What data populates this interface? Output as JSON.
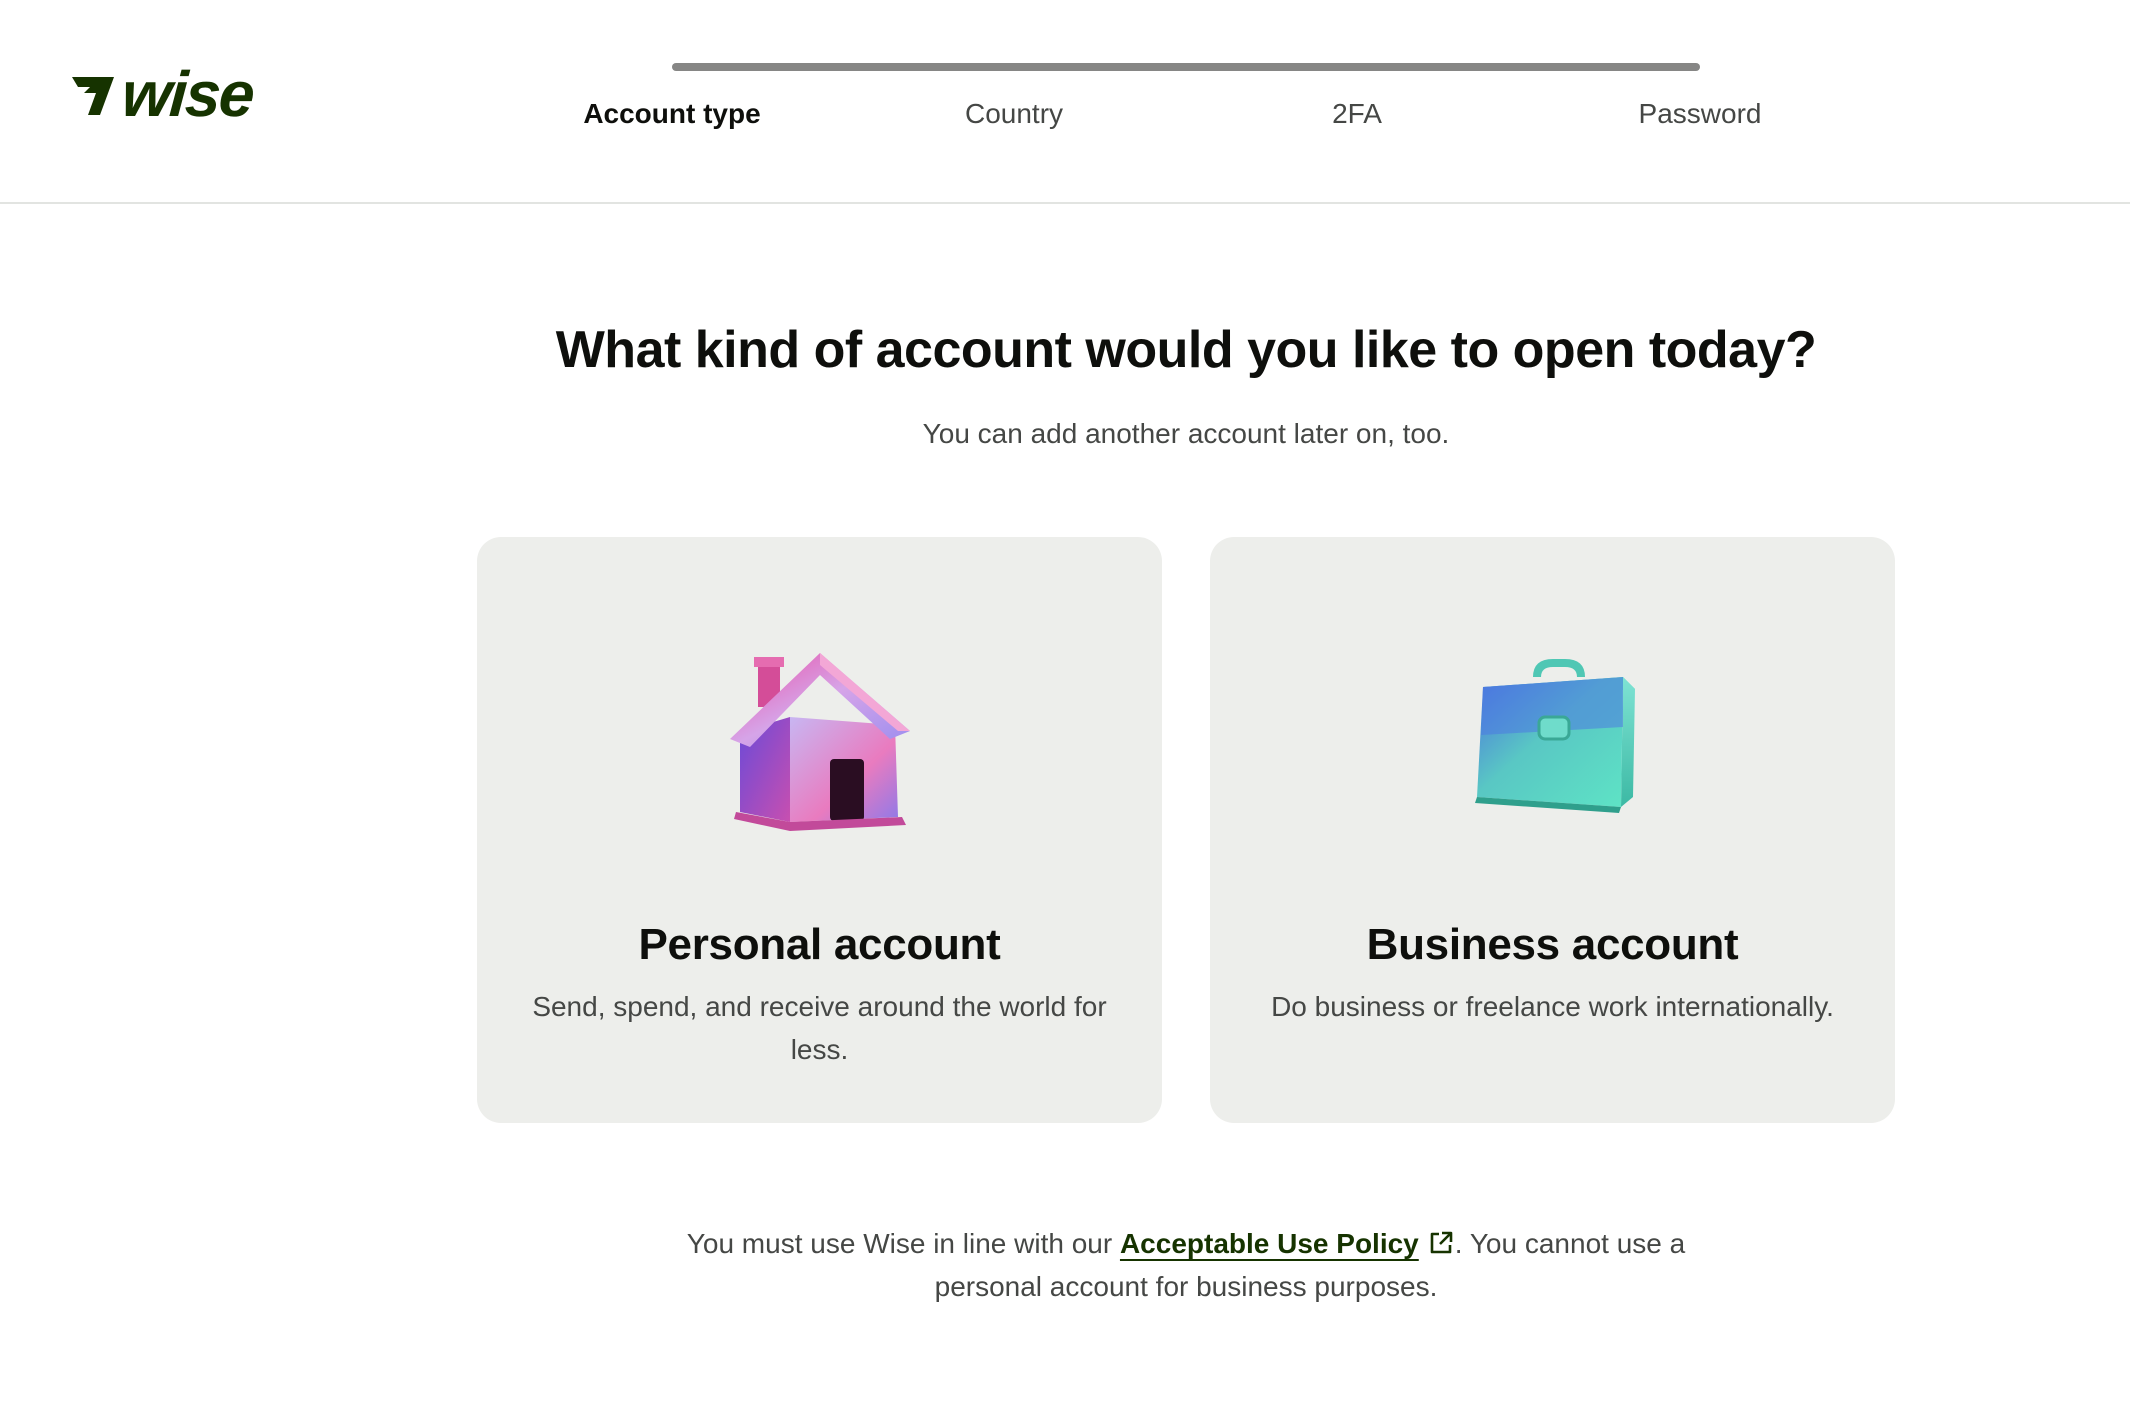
{
  "brand": {
    "name": "wise",
    "color": "#163300",
    "logo_icon": "wise-flag-icon"
  },
  "progress": {
    "percent": 100,
    "color": "#868685",
    "steps": [
      {
        "label": "Account type",
        "active": true
      },
      {
        "label": "Country",
        "active": false
      },
      {
        "label": "2FA",
        "active": false
      },
      {
        "label": "Password",
        "active": false
      }
    ]
  },
  "main": {
    "title": "What kind of account would you like to open today?",
    "subtitle": "You can add another account later on, too."
  },
  "cards": [
    {
      "title": "Personal account",
      "description": "Send, spend, and receive around the world for less.",
      "icon": "house-icon"
    },
    {
      "title": "Business account",
      "description": "Do business or freelance work internationally.",
      "icon": "briefcase-icon"
    }
  ],
  "policy": {
    "prefix": "You must use Wise in line with our ",
    "link_label": "Acceptable Use Policy",
    "suffix": ". You cannot use a personal account for business purposes.",
    "link_icon": "external-link-icon"
  },
  "colors": {
    "card_background": "#edeeeb",
    "text_primary": "#0e0f0c",
    "text_secondary": "#454745",
    "divider": "#e2e4e1"
  }
}
